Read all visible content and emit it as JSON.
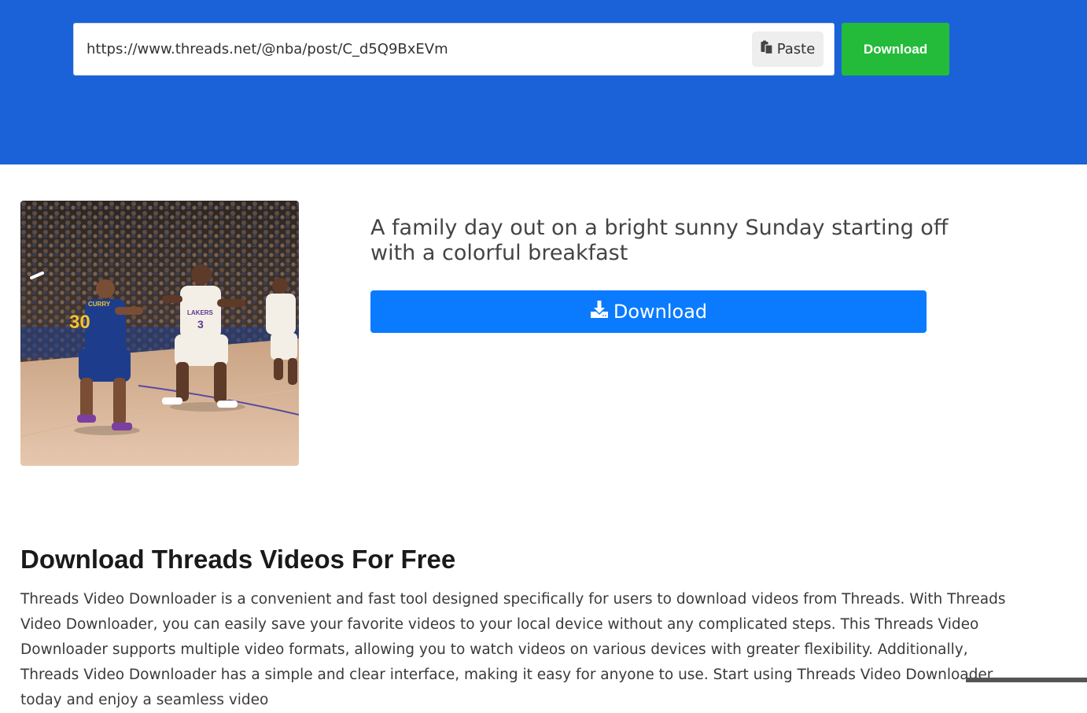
{
  "search": {
    "url_value": "https://www.threads.net/@nba/post/C_d5Q9BxEVm",
    "paste_label": "Paste",
    "submit_label": "Download"
  },
  "result": {
    "caption": "A family day out on a bright sunny Sunday starting off with a colorful breakfast",
    "download_label": "Download",
    "thumbnail": {
      "jersey_left": "30",
      "jersey_left_name": "CURRY",
      "jersey_right": "3",
      "jersey_right_name": "LAKERS"
    }
  },
  "article": {
    "title": "Download Threads Videos For Free",
    "body": "Threads Video Downloader is a convenient and fast tool designed specifically for users to download videos from Threads. With Threads Video Downloader, you can easily save your favorite videos to your local device without any complicated steps. This Threads Video Downloader supports multiple video formats, allowing you to watch videos on various devices with greater flexibility. Additionally, Threads Video Downloader has a simple and clear interface, making it easy for anyone to use. Start using Threads Video Downloader today and enjoy a seamless video"
  },
  "colors": {
    "hero_bg": "#1b62d8",
    "submit_bg": "#24bb3a",
    "download_bg": "#0a7bff"
  },
  "icons": {
    "paste": "clipboard-icon",
    "download": "download-icon"
  }
}
